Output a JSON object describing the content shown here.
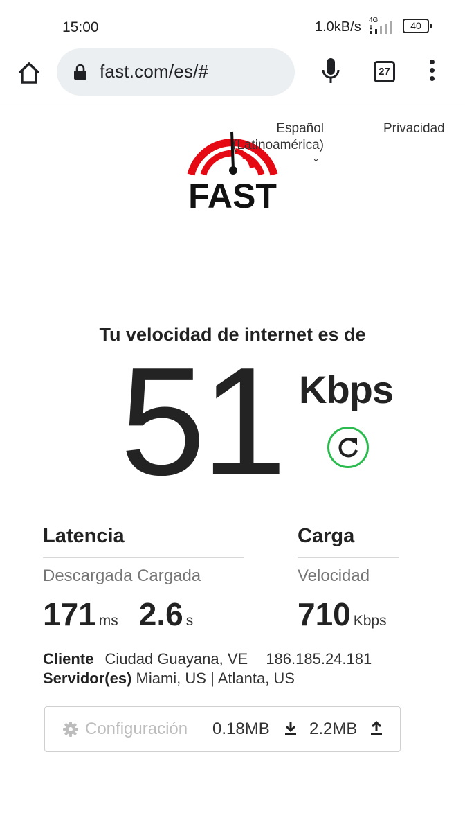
{
  "status_bar": {
    "time": "15:00",
    "net_speed": "1.0kB/s",
    "network_type": "4G",
    "battery": "40"
  },
  "browser": {
    "url": "fast.com/es/#",
    "tab_count": "27",
    "icons": [
      "home-icon",
      "lock-icon",
      "mic-icon",
      "tab-switcher-icon",
      "more-vert-icon"
    ]
  },
  "header": {
    "logo_text": "FAST",
    "language": "Español (Latinoamérica)",
    "language_chevron": "⌄",
    "privacy": "Privacidad"
  },
  "result": {
    "heading": "Tu velocidad de internet es de",
    "speed": "51",
    "unit": "Kbps"
  },
  "latency": {
    "title": "Latencia",
    "subtitle": "Descargada Cargada",
    "unloaded_value": "171",
    "unloaded_unit": "ms",
    "loaded_value": "2.6",
    "loaded_unit": "s"
  },
  "upload": {
    "title": "Carga",
    "subtitle": "Velocidad",
    "value": "710",
    "unit": "Kbps"
  },
  "client": {
    "label": "Cliente",
    "location": "Ciudad Guayana, VE",
    "ip": "186.185.24.181"
  },
  "servers": {
    "label": "Servidor(es)",
    "list": "Miami, US  |  Atlanta, US"
  },
  "config": {
    "label": "Configuración",
    "downloaded": "0.18MB",
    "uploaded": "2.2MB"
  },
  "colors": {
    "brand_red": "#e50914",
    "refresh_green": "#2bbb4e"
  }
}
